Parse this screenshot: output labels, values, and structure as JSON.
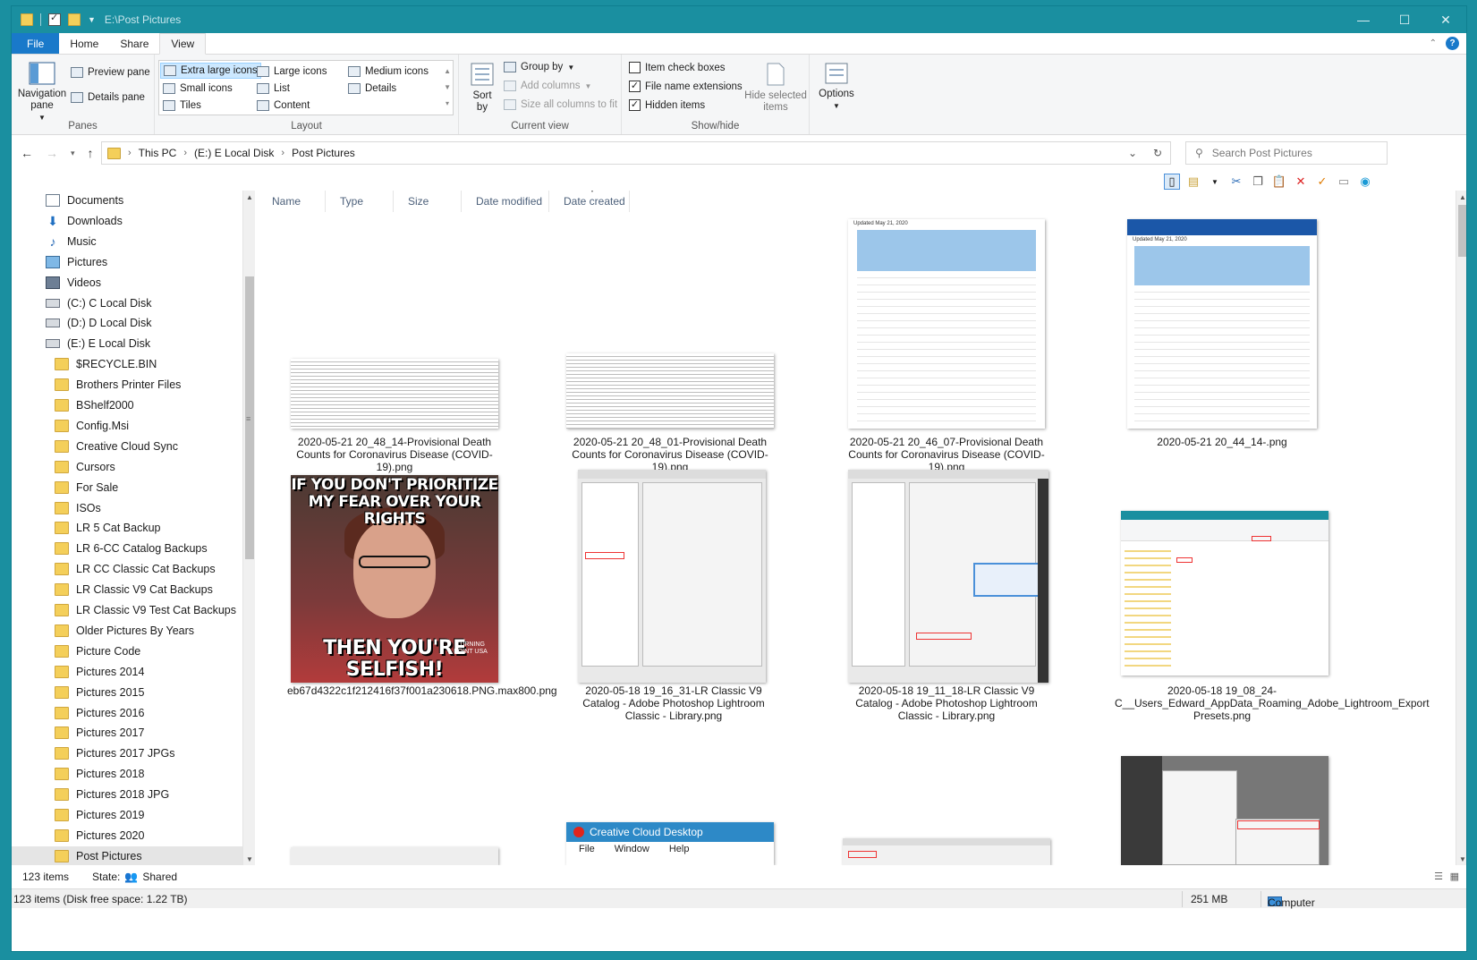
{
  "window": {
    "title": "E:\\Post Pictures",
    "controls": [
      "—",
      "☐",
      "✕"
    ]
  },
  "ribbon_tabs": [
    "File",
    "Home",
    "Share",
    "View"
  ],
  "ribbon": {
    "panes": {
      "navigation_pane": "Navigation pane",
      "preview_pane": "Preview pane",
      "details_pane": "Details pane",
      "label": "Panes"
    },
    "layout": {
      "items": [
        "Extra large icons",
        "Large icons",
        "Medium icons",
        "Small icons",
        "List",
        "Details",
        "Tiles",
        "Content"
      ],
      "label": "Layout"
    },
    "current_view": {
      "sort_by": "Sort by",
      "group_by": "Group by",
      "add_columns": "Add columns",
      "size_all": "Size all columns to fit",
      "label": "Current view"
    },
    "show_hide": {
      "item_check_boxes": "Item check boxes",
      "file_name_extensions": "File name extensions",
      "hidden_items": "Hidden items",
      "hide_selected": "Hide selected items",
      "label": "Show/hide"
    },
    "options": "Options"
  },
  "address": {
    "crumbs": [
      "This PC",
      "(E:) E Local Disk",
      "Post Pictures"
    ],
    "search_placeholder": "Search Post Pictures"
  },
  "nav": [
    {
      "label": "Documents",
      "icon": "documents-icon",
      "indent": 0
    },
    {
      "label": "Downloads",
      "icon": "downloads-icon",
      "indent": 0
    },
    {
      "label": "Music",
      "icon": "music-icon",
      "indent": 0
    },
    {
      "label": "Pictures",
      "icon": "pictures-icon",
      "indent": 0
    },
    {
      "label": "Videos",
      "icon": "videos-icon",
      "indent": 0
    },
    {
      "label": "(C:) C Local Disk",
      "icon": "drive-icon",
      "indent": 0
    },
    {
      "label": "(D:) D Local Disk",
      "icon": "drive-icon",
      "indent": 0
    },
    {
      "label": "(E:) E Local Disk",
      "icon": "drive-icon",
      "indent": 0
    },
    {
      "label": "$RECYCLE.BIN",
      "icon": "folder-icon",
      "indent": 1
    },
    {
      "label": "Brothers Printer Files",
      "icon": "folder-icon",
      "indent": 1
    },
    {
      "label": "BShelf2000",
      "icon": "folder-icon",
      "indent": 1
    },
    {
      "label": "Config.Msi",
      "icon": "folder-icon",
      "indent": 1
    },
    {
      "label": "Creative Cloud Sync",
      "icon": "folder-icon",
      "indent": 1
    },
    {
      "label": "Cursors",
      "icon": "folder-icon",
      "indent": 1
    },
    {
      "label": "For Sale",
      "icon": "folder-icon",
      "indent": 1
    },
    {
      "label": "ISOs",
      "icon": "folder-icon",
      "indent": 1
    },
    {
      "label": "LR 5 Cat Backup",
      "icon": "folder-icon",
      "indent": 1
    },
    {
      "label": "LR 6-CC Catalog Backups",
      "icon": "folder-icon",
      "indent": 1
    },
    {
      "label": "LR CC Classic Cat Backups",
      "icon": "folder-icon",
      "indent": 1
    },
    {
      "label": "LR Classic V9 Cat Backups",
      "icon": "folder-icon",
      "indent": 1
    },
    {
      "label": "LR Classic V9 Test Cat Backups",
      "icon": "folder-icon",
      "indent": 1
    },
    {
      "label": "Older Pictures By Years",
      "icon": "folder-icon",
      "indent": 1
    },
    {
      "label": "Picture Code",
      "icon": "folder-icon",
      "indent": 1
    },
    {
      "label": "Pictures 2014",
      "icon": "folder-icon",
      "indent": 1
    },
    {
      "label": "Pictures 2015",
      "icon": "folder-icon",
      "indent": 1
    },
    {
      "label": "Pictures 2016",
      "icon": "folder-icon",
      "indent": 1
    },
    {
      "label": "Pictures 2017",
      "icon": "folder-icon",
      "indent": 1
    },
    {
      "label": "Pictures 2017 JPGs",
      "icon": "folder-icon",
      "indent": 1
    },
    {
      "label": "Pictures 2018",
      "icon": "folder-icon",
      "indent": 1
    },
    {
      "label": "Pictures 2018 JPG",
      "icon": "folder-icon",
      "indent": 1
    },
    {
      "label": "Pictures 2019",
      "icon": "folder-icon",
      "indent": 1
    },
    {
      "label": "Pictures 2020",
      "icon": "folder-icon",
      "indent": 1
    },
    {
      "label": "Post Pictures",
      "icon": "folder-icon",
      "indent": 1,
      "selected": true
    }
  ],
  "columns": [
    "Name",
    "Type",
    "Size",
    "Date modified",
    "Date created"
  ],
  "files": [
    {
      "name": "2020-05-21 20_48_14-Provisional Death Counts for Coronavirus Disease (COVID-19).png",
      "kind": "text"
    },
    {
      "name": "2020-05-21 20_48_01-Provisional Death Counts for Coronavirus Disease (COVID-19).png",
      "kind": "text"
    },
    {
      "name": "2020-05-21 20_46_07-Provisional Death Counts for Coronavirus Disease (COVID-19).png",
      "kind": "table"
    },
    {
      "name": "2020-05-21 20_44_14-.png",
      "kind": "table"
    },
    {
      "name": "eb67d4322c1f212416f37f001a230618.PNG.max800.png",
      "kind": "meme"
    },
    {
      "name": "2020-05-18 19_16_31-LR Classic V9 Catalog - Adobe Photoshop Lightroom Classic - Library.png",
      "kind": "shot"
    },
    {
      "name": "2020-05-18 19_11_18-LR Classic V9 Catalog - Adobe Photoshop Lightroom Classic - Library.png",
      "kind": "shot"
    },
    {
      "name": "2020-05-18 19_08_24-C__Users_Edward_AppData_Roaming_Adobe_Lightroom_Export Presets.png",
      "kind": "shot"
    }
  ],
  "thumb_text": {
    "table_updated": "Updated May 21, 2020",
    "meme_top": "IF YOU DON'T PRIORITIZE MY FEAR OVER YOUR RIGHTS",
    "meme_bottom": "THEN YOU'RE SELFISH!",
    "meme_logo": "TURNING POINT USA",
    "cc_title": "Creative Cloud Desktop",
    "cc_menu": [
      "File",
      "Window",
      "Help"
    ]
  },
  "status": {
    "items_count": "123 items",
    "state_label": "State:",
    "state_value": "Shared",
    "disk_info": "123 items (Disk free space: 1.22 TB)",
    "size": "251 MB",
    "location": "Computer"
  },
  "colors": {
    "accent": "#1a8fa0",
    "file_tab": "#1979ca",
    "selection": "#cce8ff"
  }
}
